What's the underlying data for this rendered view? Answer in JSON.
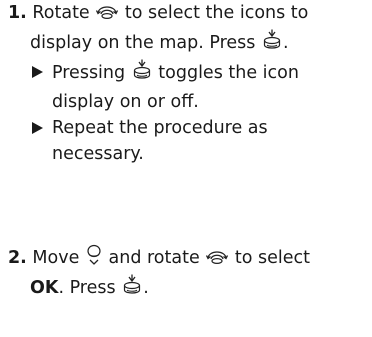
{
  "step1": {
    "number": "1.",
    "line1a": "Rotate",
    "line1b": "to select the icons to",
    "line2a": "display on the map. Press",
    "line2b": ".",
    "bullets": [
      {
        "a": "Pressing",
        "b": "toggles the icon",
        "c": "display on or off."
      },
      {
        "a": "Repeat the procedure as",
        "c": "necessary."
      }
    ]
  },
  "step2": {
    "number": "2.",
    "a": "Move",
    "b": "and rotate",
    "c": "to select",
    "ok": "OK",
    "d": ". Press",
    "e": "."
  },
  "icons": {
    "rotate": "interface-dial-rotate-icon",
    "press": "interface-dial-press-icon",
    "move": "interface-dial-move-icon"
  }
}
